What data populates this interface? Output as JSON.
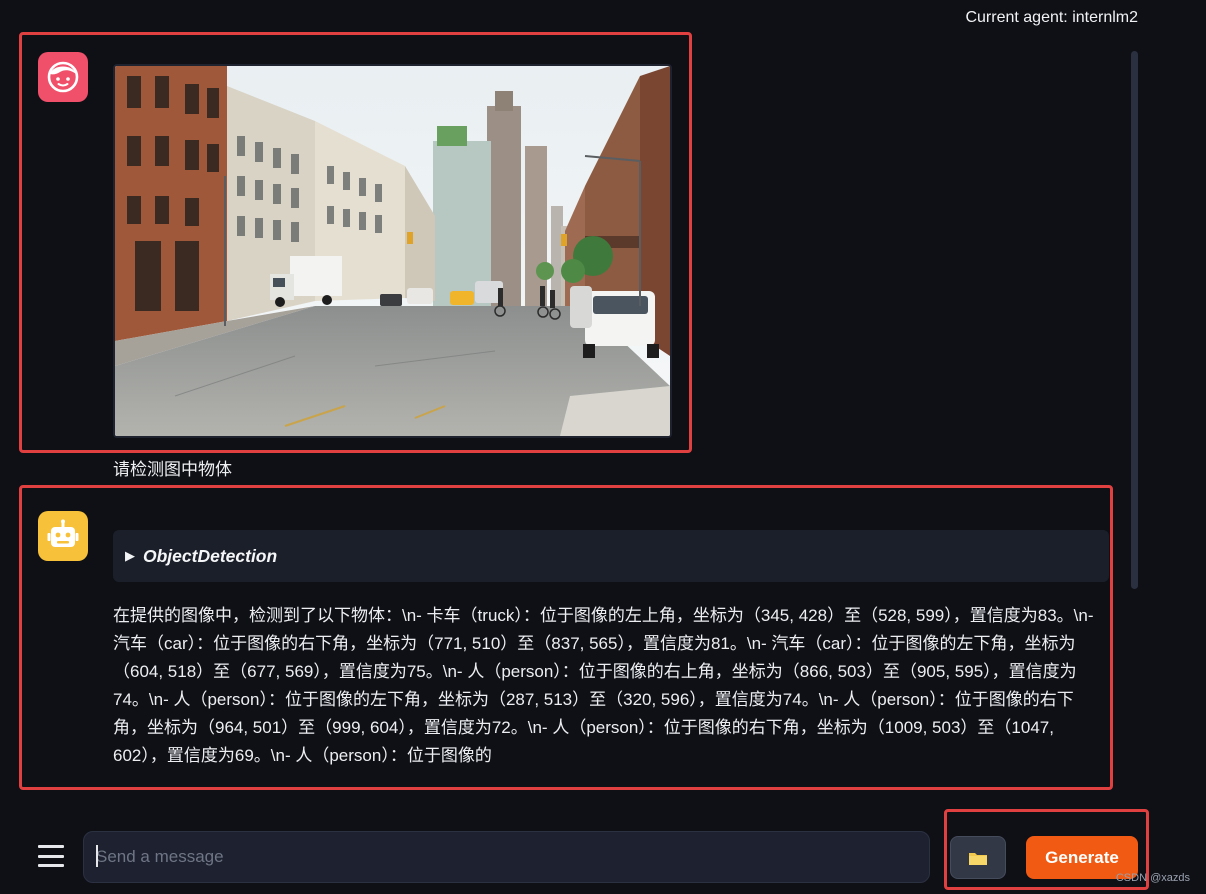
{
  "header": {
    "current_agent": "Current agent: internlm2"
  },
  "chat": {
    "user_message": {
      "avatar_icon": "user-face-icon",
      "image_icon": "street-photo",
      "text": "请检测图中物体"
    },
    "bot_message": {
      "avatar_icon": "robot-icon",
      "tool_name": "ObjectDetection",
      "response": "在提供的图像中，检测到了以下物体：\\n- 卡车（truck）：位于图像的左上角，坐标为（345, 428）至（528, 599），置信度为83。\\n- 汽车（car）：位于图像的右下角，坐标为（771, 510）至（837, 565），置信度为81。\\n- 汽车（car）：位于图像的左下角，坐标为（604, 518）至（677, 569），置信度为75。\\n- 人（person）：位于图像的右上角，坐标为（866, 503）至（905, 595），置信度为74。\\n- 人（person）：位于图像的左下角，坐标为（287, 513）至（320, 596），置信度为74。\\n- 人（person）：位于图像的右下角，坐标为（964, 501）至（999, 604），置信度为72。\\n- 人（person）：位于图像的右下角，坐标为（1009, 503）至（1047, 602），置信度为69。\\n- 人（person）：位于图像的"
    }
  },
  "composer": {
    "menu_icon": "hamburger-menu-icon",
    "placeholder": "Send a message",
    "upload_icon": "folder-icon",
    "generate_label": "Generate"
  },
  "watermark": "CSDN @xazds",
  "colors": {
    "background": "#0e1016",
    "annotation_red": "#e0403f",
    "generate_orange": "#f05a12",
    "user_avatar": "#f0506a",
    "bot_avatar": "#f7c23a"
  }
}
